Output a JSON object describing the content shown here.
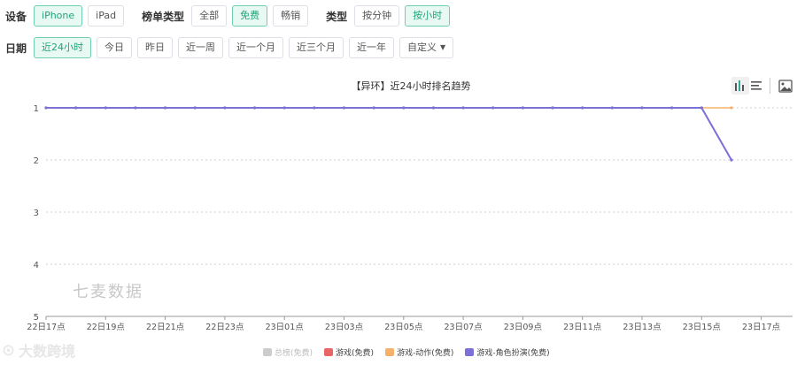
{
  "filters": {
    "device": {
      "label": "设备",
      "options": [
        "iPhone",
        "iPad"
      ],
      "active": 0
    },
    "list_type": {
      "label": "榜单类型",
      "options": [
        "全部",
        "免费",
        "畅销"
      ],
      "active": 1
    },
    "type": {
      "label": "类型",
      "options": [
        "按分钟",
        "按小时"
      ],
      "active": 1
    },
    "date": {
      "label": "日期",
      "options": [
        "近24小时",
        "今日",
        "昨日",
        "近一周",
        "近一个月",
        "近三个月",
        "近一年"
      ],
      "active": 0,
      "custom_label": "自定义"
    }
  },
  "toolbar": {
    "bar_icon": "bar-chart-icon",
    "list_icon": "list-icon",
    "image_icon": "image-icon"
  },
  "watermark": "七麦数据",
  "brand": {
    "text": "大数跨境",
    "icon": "logo-icon"
  },
  "chart_data": {
    "type": "line",
    "title": "【异环】近24小时排名趋势",
    "xlabel": "",
    "ylabel": "",
    "y_inverted": true,
    "ylim": [
      1,
      5
    ],
    "yticks": [
      1,
      2,
      3,
      4,
      5
    ],
    "x": [
      "22日17点",
      "22日18点",
      "22日19点",
      "22日20点",
      "22日21点",
      "22日22点",
      "22日23点",
      "23日00点",
      "23日01点",
      "23日02点",
      "23日03点",
      "23日04点",
      "23日05点",
      "23日06点",
      "23日07点",
      "23日08点",
      "23日09点",
      "23日10点",
      "23日11点",
      "23日12点",
      "23日13点",
      "23日14点",
      "23日15点",
      "23日16点",
      "23日17点"
    ],
    "x_tick_labels": [
      "22日17点",
      "22日19点",
      "22日21点",
      "22日23点",
      "23日01点",
      "23日03点",
      "23日05点",
      "23日07点",
      "23日09点",
      "23日11点",
      "23日13点",
      "23日15点",
      "23日17点"
    ],
    "series": [
      {
        "name": "总榜(免费)",
        "color": "#cccccc",
        "visible": false,
        "values": []
      },
      {
        "name": "游戏(免费)",
        "color": "#e86666",
        "visible": true,
        "values": []
      },
      {
        "name": "游戏-动作(免费)",
        "color": "#f5b06a",
        "visible": true,
        "values": [
          1,
          1,
          1,
          1,
          1,
          1,
          1,
          1,
          1,
          1,
          1,
          1,
          1,
          1,
          1,
          1,
          1,
          1,
          1,
          1,
          1,
          1,
          1,
          1
        ]
      },
      {
        "name": "游戏-角色扮演(免费)",
        "color": "#7b6fd8",
        "visible": true,
        "values": [
          1,
          1,
          1,
          1,
          1,
          1,
          1,
          1,
          1,
          1,
          1,
          1,
          1,
          1,
          1,
          1,
          1,
          1,
          1,
          1,
          1,
          1,
          1,
          2
        ]
      }
    ],
    "grid": true,
    "legend_position": "bottom"
  }
}
